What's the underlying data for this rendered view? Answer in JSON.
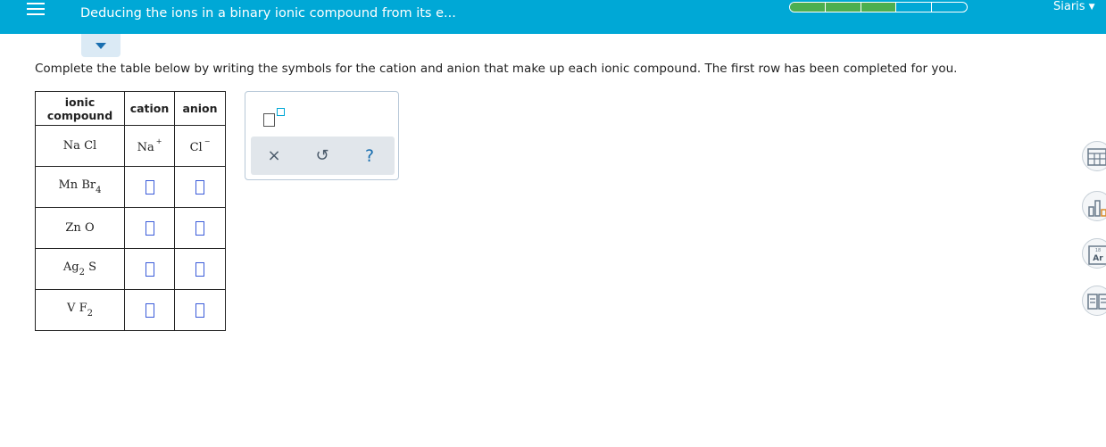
{
  "header": {
    "title": "Deducing the ions in a binary ionic compound from its e...",
    "progress_segments": [
      true,
      true,
      true,
      false,
      false
    ],
    "progress_color": "#4caf50",
    "user_name": "Siaris",
    "header_color": "#00a8d6"
  },
  "instructions": "Complete the table below by writing the symbols for the cation and anion that make up each ionic compound. The first row has been completed for you.",
  "table": {
    "headers": {
      "compound_line1": "ionic",
      "compound_line2": "compound",
      "cation": "cation",
      "anion": "anion"
    },
    "rows": [
      {
        "formula": {
          "a": "Na",
          "b": "Cl",
          "sub_b": ""
        },
        "cation": "Na",
        "cation_charge": "+",
        "anion": "Cl",
        "anion_charge": "−"
      },
      {
        "formula": {
          "a": "Mn",
          "b": "Br",
          "sub_b": "4"
        }
      },
      {
        "formula": {
          "a": "Zn",
          "b": "O",
          "sub_b": ""
        }
      },
      {
        "formula": {
          "a": "Ag",
          "sub_a": "2",
          "b": "S"
        }
      },
      {
        "formula": {
          "a": "V",
          "b": "F",
          "sub_b": "2"
        }
      }
    ]
  },
  "toolbar": {
    "clear_symbol": "×",
    "undo_symbol": "↺",
    "help_symbol": "?"
  },
  "side_tools": {
    "periodic_number": "18",
    "periodic_symbol": "Ar"
  },
  "icons": [
    "menu-icon",
    "superscript-icon",
    "close-icon",
    "undo-icon",
    "help-icon",
    "calculator-icon",
    "chart-icon",
    "periodic-table-icon",
    "textbook-icon"
  ]
}
